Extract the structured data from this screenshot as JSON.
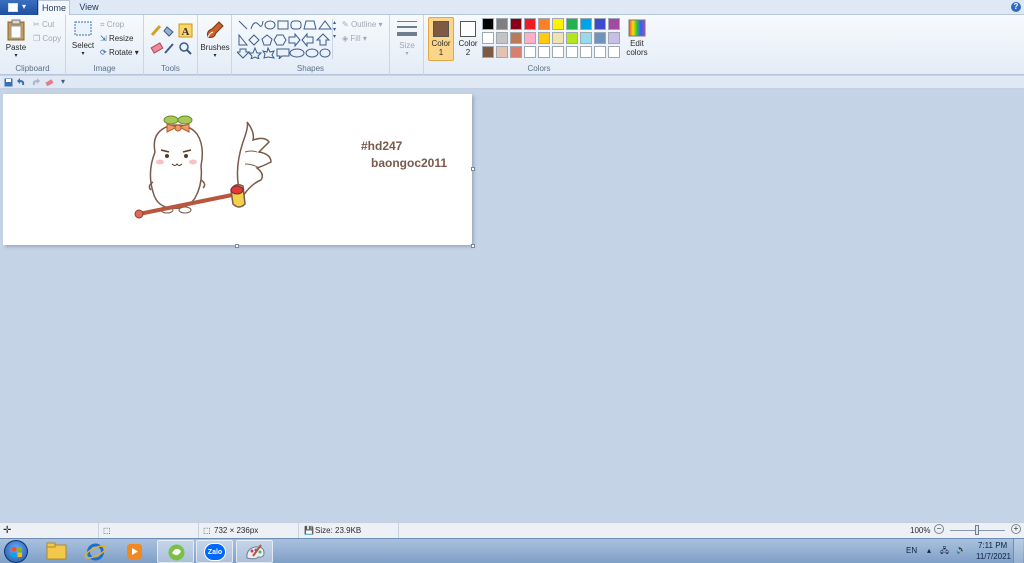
{
  "tabs": {
    "home": "Home",
    "view": "View"
  },
  "ribbon": {
    "clipboard": {
      "label": "Clipboard",
      "paste": "Paste",
      "cut": "Cut",
      "copy": "Copy"
    },
    "image": {
      "label": "Image",
      "select": "Select",
      "crop": "Crop",
      "resize": "Resize",
      "rotate": "Rotate"
    },
    "tools": {
      "label": "Tools",
      "brushes": "Brushes"
    },
    "shapes": {
      "label": "Shapes",
      "outline": "Outline",
      "fill": "Fill"
    },
    "size": {
      "label": "Size"
    },
    "colors": {
      "label": "Colors",
      "color1": "Color 1",
      "color2": "Color 2",
      "edit": "Edit colors",
      "color1_value": "#7f5a43",
      "color2_value": "#ffffff",
      "palette_row1": [
        "#000000",
        "#7f7f7f",
        "#880015",
        "#ed1c24",
        "#ff7f27",
        "#fff200",
        "#22b14c",
        "#00a2e8",
        "#3f48cc",
        "#a349a4"
      ],
      "palette_row2": [
        "#ffffff",
        "#c3c3c3",
        "#b97a57",
        "#ffaec9",
        "#ffc90e",
        "#efe4b0",
        "#b5e61d",
        "#99d9ea",
        "#7092be",
        "#c8bfe7"
      ],
      "palette_row3": [
        "#7f5a43",
        "#e3c2b2",
        "#d87f70",
        "#ffffff",
        "#ffffff",
        "#ffffff",
        "#ffffff",
        "#ffffff",
        "#ffffff",
        "#ffffff"
      ]
    }
  },
  "canvas": {
    "text1": "#hd247",
    "text2": "baongoc2011"
  },
  "status": {
    "dimensions": "732 × 236px",
    "size": "Size: 23.9KB",
    "zoom": "100%"
  },
  "tray": {
    "lang": "EN",
    "time": "7:11 PM",
    "date": "11/7/2021"
  },
  "taskbar": {
    "zalo": "Zalo"
  }
}
